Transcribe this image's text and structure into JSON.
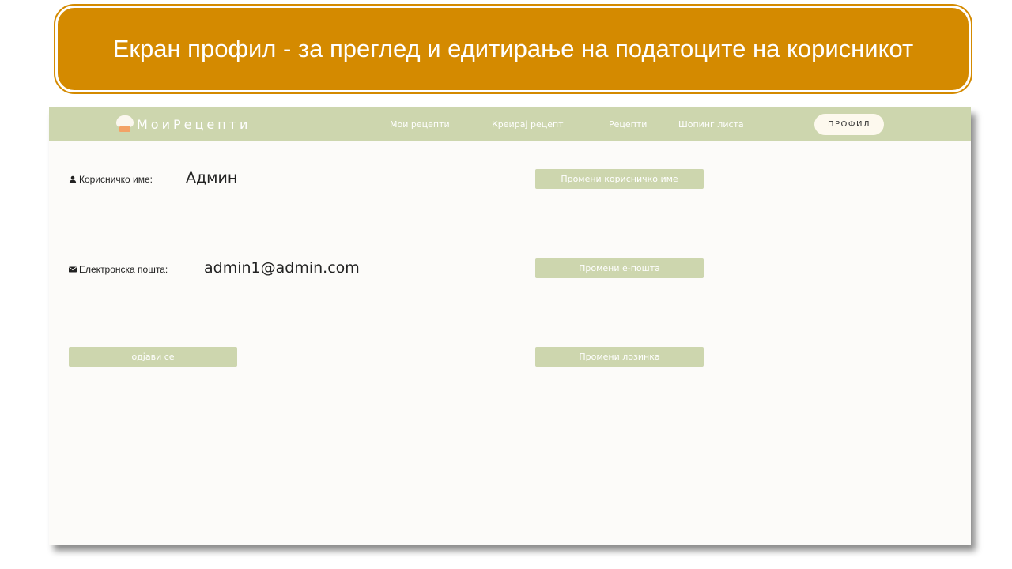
{
  "slide_title": "Екран профил - за преглед и едитирање на податоците на корисникот",
  "app": {
    "logo_text": "МоиРецепти",
    "nav": {
      "my_recipes": "Мои рецепти",
      "create_recipe": "Креирај рецепт",
      "recipes": "Рецепти",
      "shopping_list": "Шопинг листа",
      "profile": "ПРОФИЛ"
    },
    "profile": {
      "username_label": "Корисничко име:",
      "username_value": "Админ",
      "email_label": "Електронска пошта:",
      "email_value": "admin1@admin.com",
      "change_username": "Промени корисничко име",
      "change_email": "Промени е-пошта",
      "change_password": "Промени лозинка",
      "logout": "одјави се"
    },
    "icons": {
      "username": "user-icon",
      "email": "envelope-icon",
      "logo": "chef-hat-icon"
    }
  },
  "colors": {
    "banner": "#d48a00",
    "navbar": "#cdd6ae",
    "button": "#cdd6ae",
    "background": "#fcfbf9"
  }
}
